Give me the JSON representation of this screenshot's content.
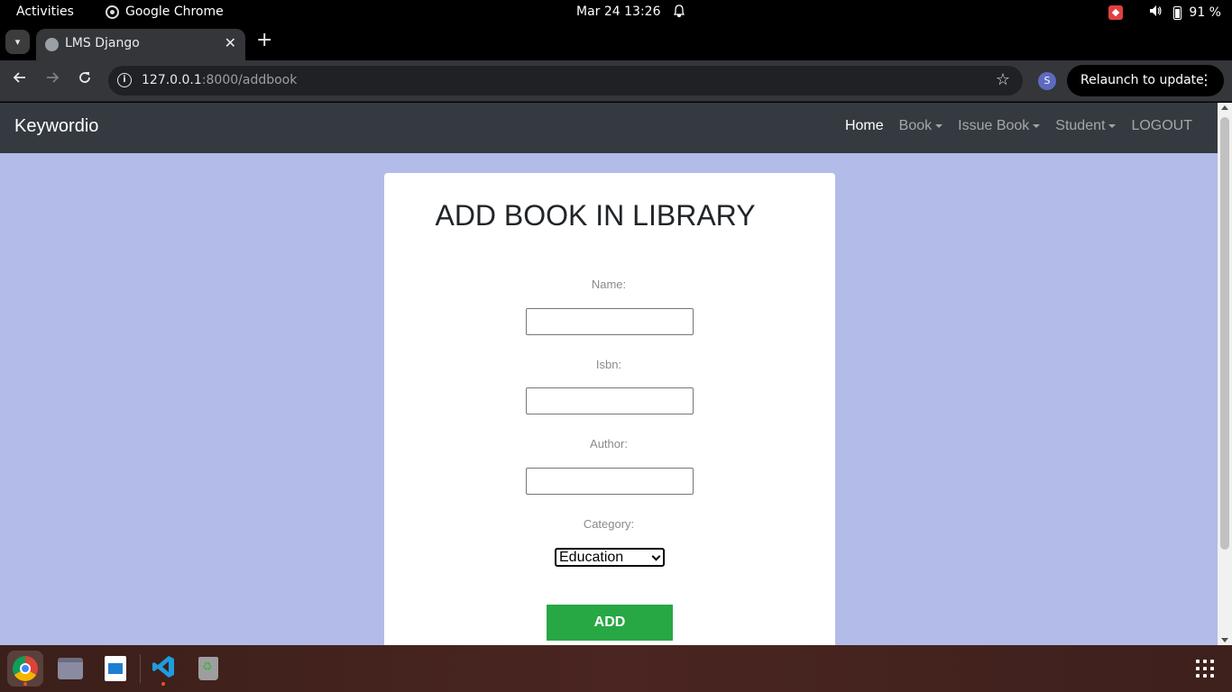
{
  "system_bar": {
    "activities": "Activities",
    "app_name": "Google Chrome",
    "datetime": "Mar 24  13:26",
    "battery": "91 %"
  },
  "browser": {
    "tab_title": "LMS Django",
    "url_host": "127.0.0.1",
    "url_path": ":8000/addbook",
    "profile_initial": "S",
    "relaunch_label": "Relaunch to update"
  },
  "navbar": {
    "brand": "Keywordio",
    "links": [
      "Home",
      "Book",
      "Issue Book",
      "Student",
      "LOGOUT"
    ]
  },
  "form": {
    "title": "ADD BOOK IN LIBRARY",
    "fields": {
      "name_label": "Name:",
      "name_value": "",
      "isbn_label": "Isbn:",
      "isbn_value": "",
      "author_label": "Author:",
      "author_value": "",
      "category_label": "Category:",
      "category_value": "Education"
    },
    "submit_label": "ADD"
  },
  "colors": {
    "page_bg": "#b3bbe8",
    "navbar_bg": "#343a40",
    "submit_bg": "#28a745"
  }
}
